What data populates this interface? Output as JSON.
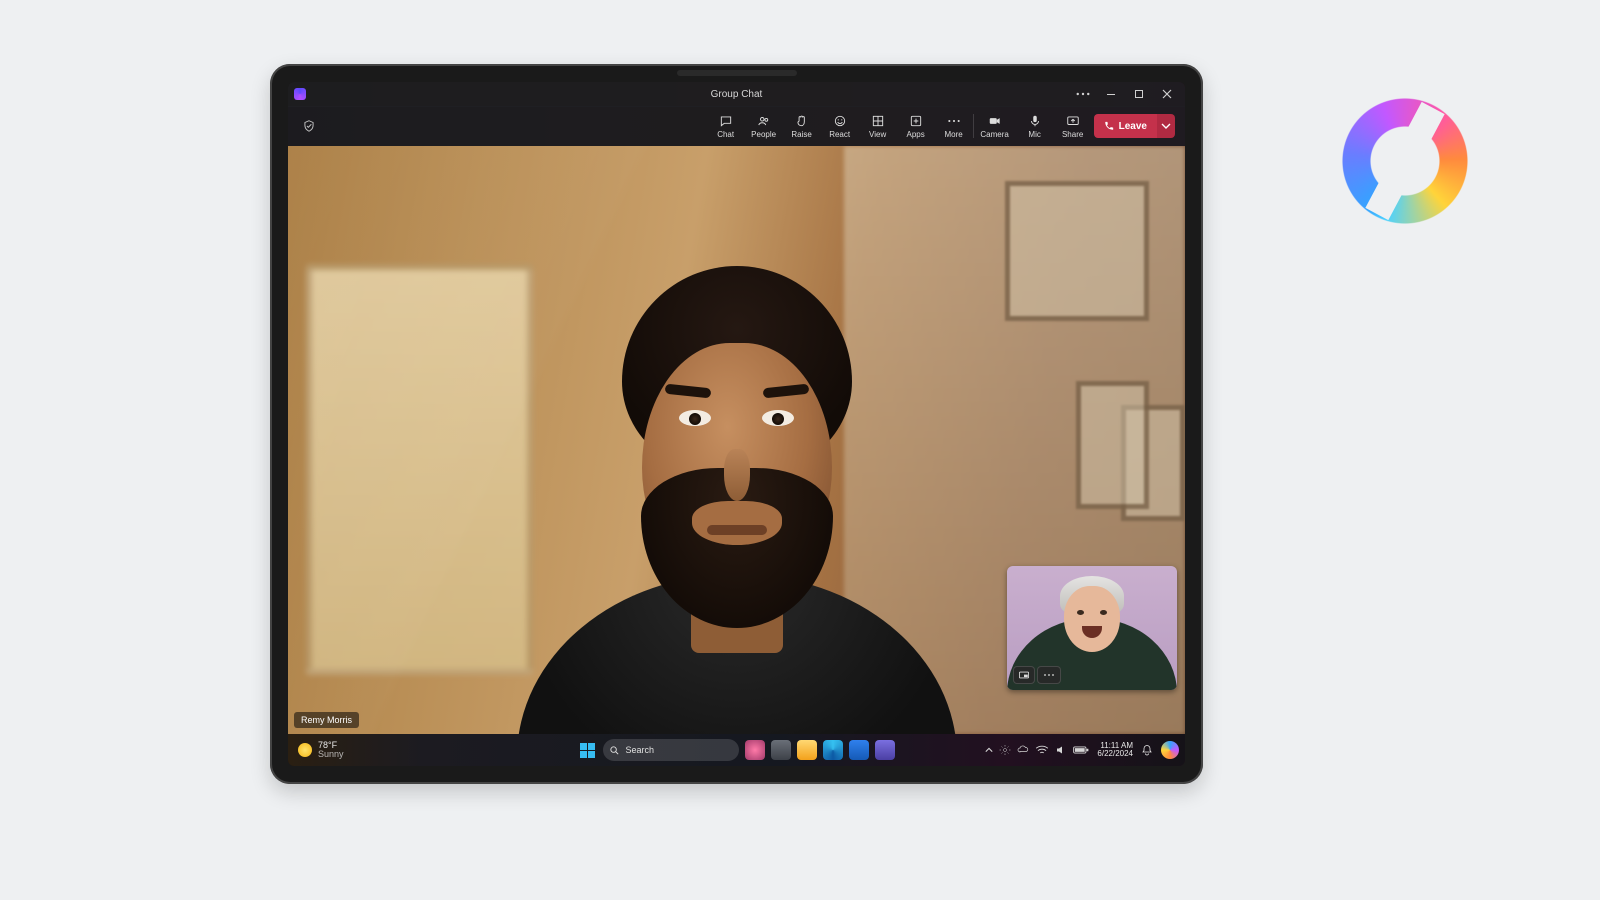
{
  "window": {
    "title": "Group Chat"
  },
  "toolbar": {
    "chat": "Chat",
    "people": "People",
    "raise": "Raise",
    "react": "React",
    "view": "View",
    "apps": "Apps",
    "more": "More",
    "camera": "Camera",
    "mic": "Mic",
    "share": "Share",
    "leave": "Leave"
  },
  "participant": {
    "primary_name": "Remy Morris"
  },
  "taskbar": {
    "search_placeholder": "Search",
    "weather_temp": "78°F",
    "weather_desc": "Sunny",
    "time": "11:11 AM",
    "date": "6/22/2024"
  }
}
